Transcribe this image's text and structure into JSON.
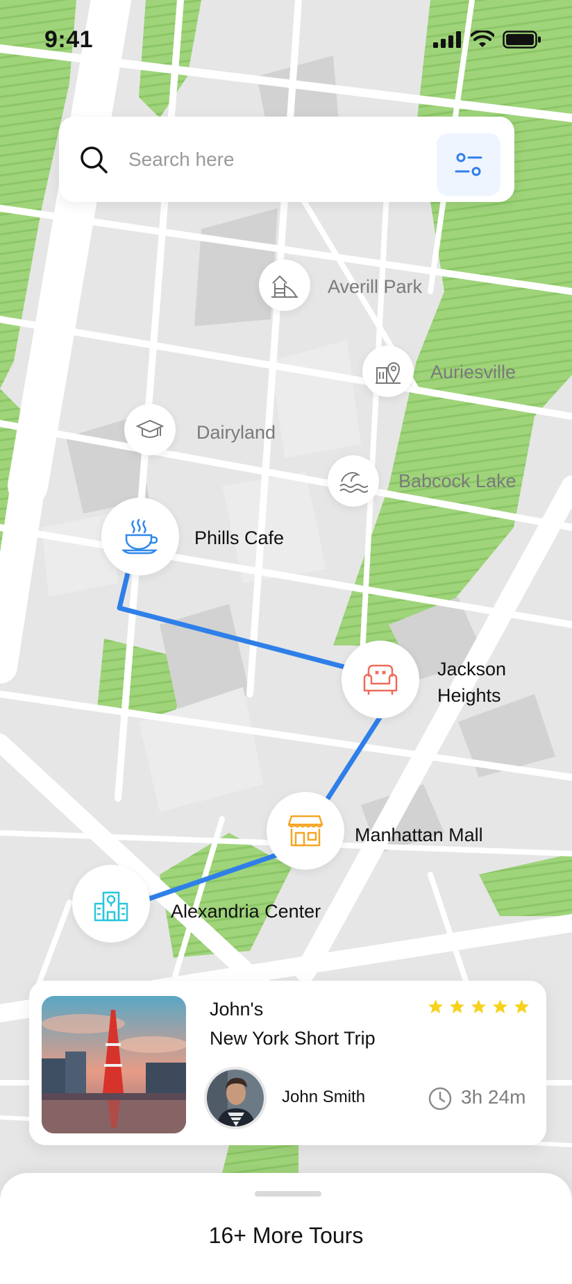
{
  "status_bar": {
    "time": "9:41",
    "icons": [
      "signal-icon",
      "wifi-icon",
      "battery-icon"
    ]
  },
  "search": {
    "placeholder": "Search here",
    "value": "",
    "icon": "search-icon",
    "filter_icon": "filter-sliders-icon"
  },
  "places": [
    {
      "name": "Averill Park",
      "icon": "playground-icon"
    },
    {
      "name": "Auriesville",
      "icon": "city-pin-icon"
    },
    {
      "name": "Dairyland",
      "icon": "graduation-cap-icon"
    },
    {
      "name": "Babcock Lake",
      "icon": "waves-icon"
    }
  ],
  "route_stops": [
    {
      "name": "Phills Cafe",
      "icon": "coffee-cup-icon",
      "color": "#2f88ec"
    },
    {
      "name_line1": "Jackson",
      "name_line2": "Heights",
      "icon": "armchair-icon",
      "color": "#ef6a5a"
    },
    {
      "name": "Manhattan Mall",
      "icon": "store-icon",
      "color": "#f5a524"
    },
    {
      "name": "Alexandria Center",
      "icon": "building-icon",
      "color": "#28c6dc"
    }
  ],
  "tour_card": {
    "owner": "John's",
    "title": "New York Short Trip",
    "rating": 5,
    "author": "John Smith",
    "duration": "3h 24m"
  },
  "bottom_sheet": {
    "label": "16+ More Tours"
  },
  "colors": {
    "route": "#2f7fe8",
    "park": "#9fd47a",
    "star": "#f7d21c",
    "accent_bg": "#eef5ff"
  }
}
